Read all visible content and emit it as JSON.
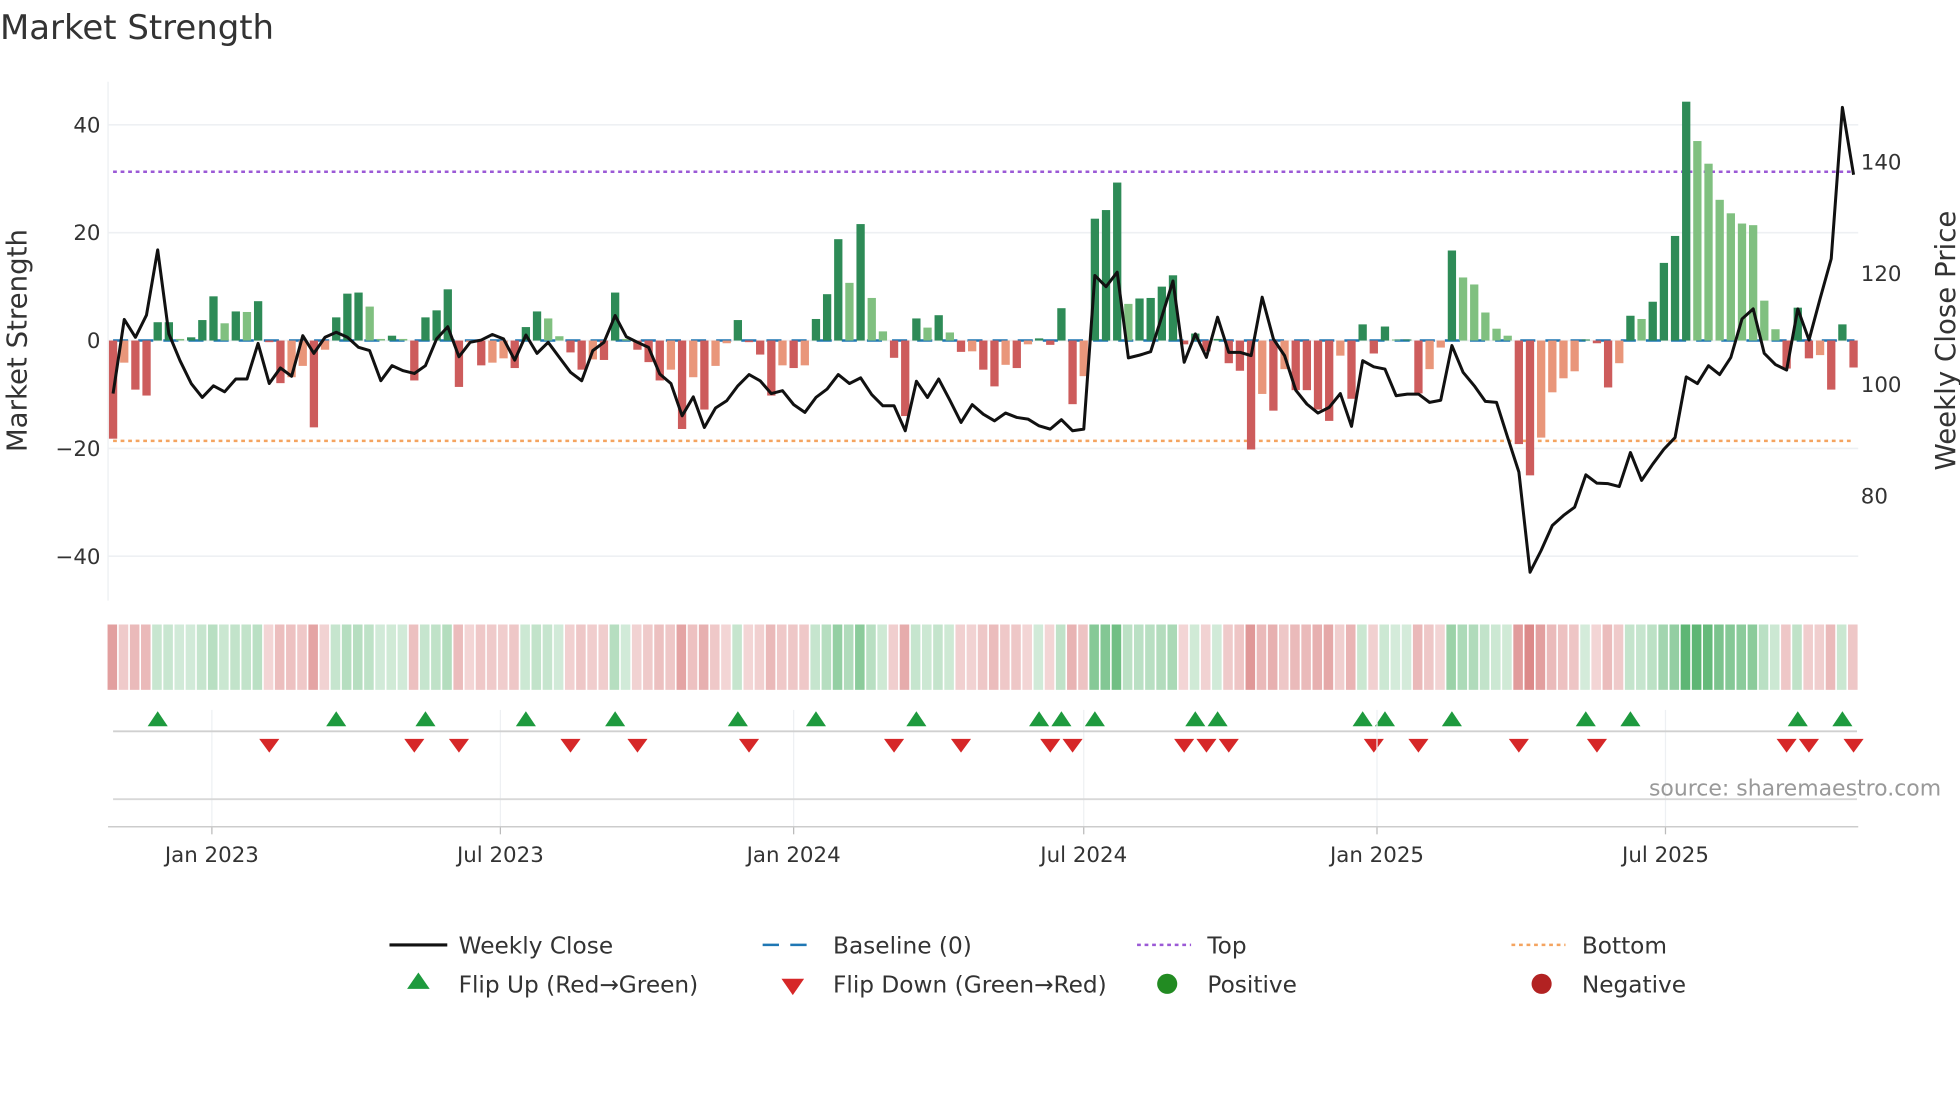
{
  "chart_data": {
    "type": "bar",
    "title": "Market Strength",
    "ylabel": "Market Strength",
    "y2label": "Weekly Close Price",
    "ylim": [
      -48,
      48
    ],
    "y2lim": [
      61.2,
      154.4
    ],
    "yticks": [
      40,
      20,
      0,
      -20,
      -40
    ],
    "ytick_labels": [
      "40",
      "20",
      "0",
      "−20",
      "−40"
    ],
    "y2ticks": [
      140,
      120,
      100,
      80
    ],
    "y2tick_labels": [
      "140",
      "120",
      "100",
      "80"
    ],
    "start_date": "2022-10-31",
    "frequency_days": 7,
    "xticks": [
      {
        "date": "2023-01-01",
        "label": "Jan 2023"
      },
      {
        "date": "2023-07-01",
        "label": "Jul 2023"
      },
      {
        "date": "2024-01-01",
        "label": "Jan 2024"
      },
      {
        "date": "2024-07-01",
        "label": "Jul 2024"
      },
      {
        "date": "2025-01-01",
        "label": "Jan 2025"
      },
      {
        "date": "2025-07-01",
        "label": "Jul 2025"
      }
    ],
    "grid": true,
    "top_level": 31.3,
    "bottom_level": -18.6,
    "baseline": 0,
    "strength": [
      -18.2,
      -4.1,
      -9.1,
      -10.2,
      3.4,
      3.4,
      0.3,
      0.6,
      3.8,
      8.2,
      3.2,
      5.4,
      5.3,
      7.3,
      -0.3,
      -7.9,
      -6.8,
      -4.7,
      -16.1,
      -1.7,
      4.3,
      8.7,
      8.9,
      6.3,
      0.3,
      0.9,
      0.3,
      -7.4,
      4.3,
      5.6,
      9.5,
      -8.6,
      -0.3,
      -4.6,
      -4.1,
      -3.3,
      -5.1,
      2.5,
      5.4,
      4.1,
      0.8,
      -2.2,
      -5.4,
      -3.5,
      -3.6,
      8.9,
      0.3,
      -1.7,
      -4.0,
      -7.4,
      -5.4,
      -16.4,
      -6.8,
      -12.8,
      -4.7,
      -0.5,
      3.8,
      -0.3,
      -2.6,
      -10.2,
      -4.6,
      -5.1,
      -4.6,
      4.0,
      8.6,
      18.8,
      10.7,
      21.6,
      7.9,
      1.7,
      -3.2,
      -14.0,
      4.1,
      2.4,
      4.7,
      1.5,
      -2.1,
      -2.0,
      -5.4,
      -8.5,
      -4.5,
      -5.1,
      -0.7,
      0.4,
      -0.8,
      6.0,
      -11.8,
      -6.6,
      22.6,
      24.2,
      29.3,
      6.8,
      7.8,
      7.9,
      10.0,
      12.1,
      -0.7,
      1.3,
      -2.0,
      0.3,
      -4.2,
      -5.6,
      -20.2,
      -9.9,
      -13.0,
      -5.3,
      -9.2,
      -9.2,
      -12.8,
      -14.9,
      -2.8,
      -10.8,
      3.0,
      -2.4,
      2.6,
      0.2,
      0.2,
      -9.8,
      -5.3,
      -1.3,
      16.7,
      11.7,
      10.4,
      5.2,
      2.2,
      0.9,
      -19.2,
      -25.0,
      -18.0,
      -9.6,
      -7.0,
      -5.7,
      0.2,
      -0.5,
      -8.7,
      -4.2,
      4.6,
      4.0,
      7.2,
      14.4,
      19.4,
      44.3,
      37.0,
      32.8,
      26.1,
      23.6,
      21.7,
      21.4,
      7.4,
      2.1,
      -5.2,
      6.1,
      -3.3,
      -2.7,
      -9.1,
      3.0,
      -5.0
    ],
    "weekly_close": [
      98.4,
      111.7,
      108.5,
      112.5,
      124.2,
      109.1,
      104.3,
      100.2,
      97.7,
      99.8,
      98.7,
      101.0,
      101.0,
      107.4,
      100.2,
      103.0,
      101.5,
      108.8,
      105.6,
      108.5,
      109.4,
      108.5,
      106.7,
      106.1,
      100.7,
      103.4,
      102.5,
      102.0,
      103.4,
      108.2,
      110.4,
      105.0,
      107.6,
      108.0,
      109.0,
      108.2,
      104.4,
      108.9,
      105.6,
      107.6,
      104.9,
      102.2,
      100.7,
      106.1,
      107.6,
      112.4,
      108.6,
      107.6,
      106.7,
      101.9,
      100.2,
      94.4,
      97.8,
      92.3,
      95.8,
      97.1,
      99.8,
      101.8,
      100.7,
      98.4,
      98.9,
      96.4,
      95.0,
      97.7,
      99.2,
      101.8,
      100.2,
      101.2,
      98.2,
      96.2,
      96.2,
      91.7,
      100.6,
      97.7,
      101.0,
      97.2,
      93.2,
      96.4,
      94.7,
      93.5,
      94.9,
      94.1,
      93.8,
      92.6,
      92.0,
      93.7,
      91.7,
      92.0,
      119.6,
      117.6,
      120.2,
      104.8,
      105.3,
      105.9,
      112.2,
      118.6,
      104.0,
      109.1,
      104.9,
      112.1,
      105.8,
      105.8,
      105.2,
      115.7,
      108.2,
      105.2,
      99.0,
      96.5,
      94.9,
      95.9,
      98.4,
      92.5,
      104.3,
      103.2,
      102.8,
      98.0,
      98.3,
      98.3,
      96.8,
      97.2,
      107.0,
      102.2,
      99.8,
      97.0,
      96.8,
      90.5,
      84.3,
      66.3,
      70.2,
      74.7,
      76.5,
      78.0,
      83.8,
      82.3,
      82.2,
      81.7,
      87.8,
      82.8,
      85.7,
      88.4,
      90.5,
      101.4,
      100.2,
      103.4,
      101.8,
      104.9,
      111.8,
      113.6,
      105.6,
      103.6,
      102.6,
      113.6,
      108.0,
      115.4,
      122.6,
      149.8,
      137.7
    ],
    "flip_up_weeks": [
      5,
      21,
      29,
      38,
      46,
      57,
      64,
      73,
      84,
      86,
      89,
      98,
      100,
      113,
      115,
      121,
      133,
      137,
      152,
      156
    ],
    "flip_down_weeks": [
      15,
      28,
      32,
      42,
      48,
      58,
      71,
      77,
      85,
      87,
      97,
      99,
      101,
      114,
      118,
      127,
      134,
      151,
      153,
      157
    ],
    "legend": {
      "placement": "bottom-center",
      "items": [
        "Weekly Close",
        "Baseline (0)",
        "Top",
        "Bottom",
        "Flip Up (Red→Green)",
        "Flip Down (Green→Red)",
        "Positive",
        "Negative"
      ]
    },
    "annotation": "source: sharemaestro.com"
  },
  "colors": {
    "pos_strong": "#2e8b57",
    "pos_weak": "#80c080",
    "neg_strong": "#cd5c5c",
    "neg_weak": "#e9967a",
    "close": "#111111",
    "baseline": "#1f77b4",
    "top": "#9b59d6",
    "bottom": "#f4a460",
    "flip_up": "#1e9a3e",
    "flip_down": "#d62728",
    "positive_dot": "#228b22",
    "negative_dot": "#b22222"
  }
}
